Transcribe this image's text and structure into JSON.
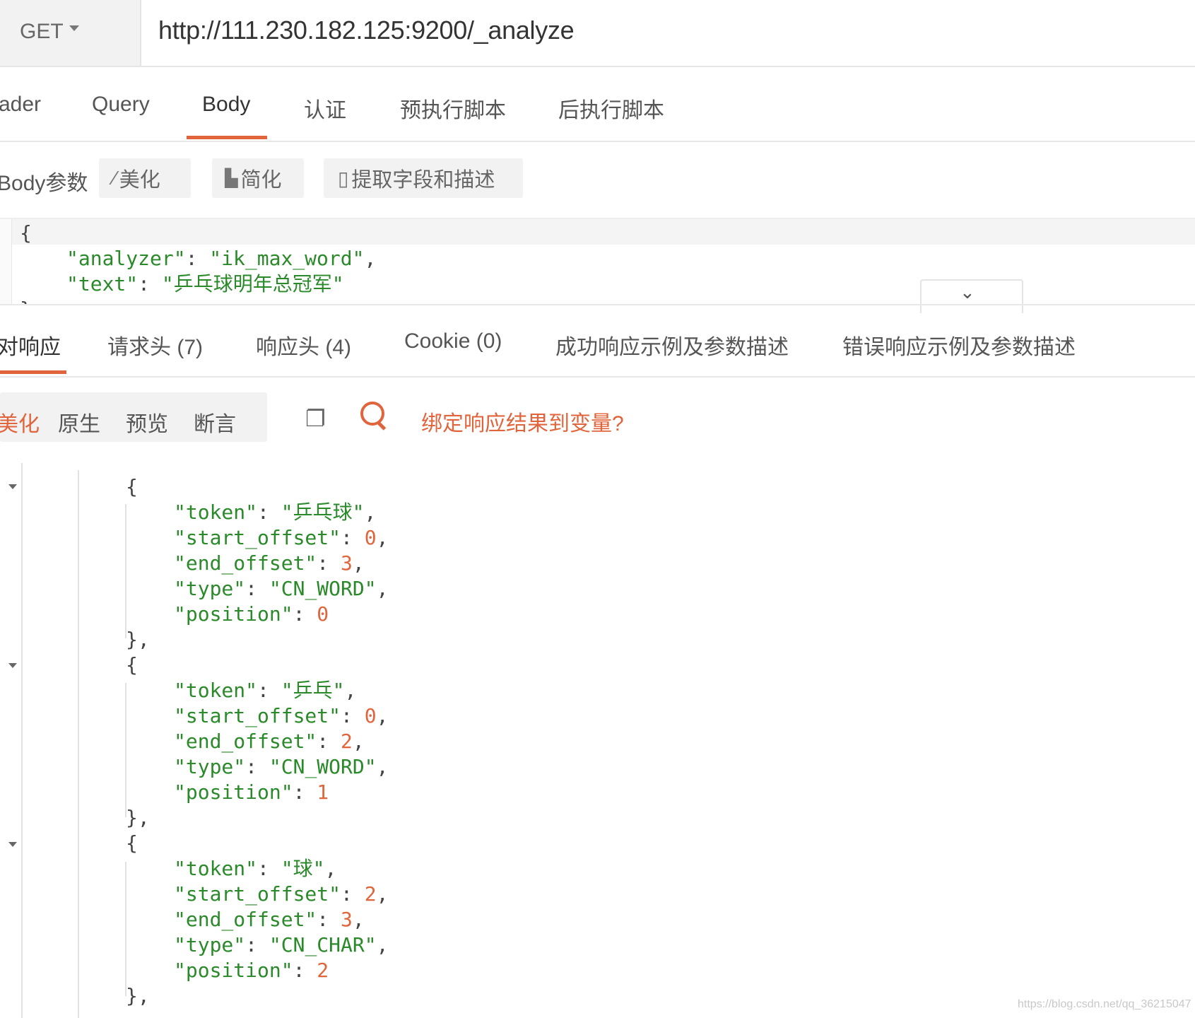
{
  "request": {
    "method": "GET",
    "url": "http://111.230.182.125:9200/_analyze"
  },
  "request_tabs": [
    {
      "label": "ader",
      "active": false
    },
    {
      "label": "Query",
      "active": false
    },
    {
      "label": "Body",
      "active": true
    },
    {
      "label": "认证",
      "active": false
    },
    {
      "label": "预执行脚本",
      "active": false
    },
    {
      "label": "后执行脚本",
      "active": false
    }
  ],
  "body_toolbar": {
    "label": "Body参数",
    "beautify": "美化",
    "simplify": "简化",
    "extract": "提取字段和描述"
  },
  "request_body": {
    "open_brace": "{",
    "k1": "\"analyzer\"",
    "v1": "\"ik_max_word\"",
    "k2": "\"text\"",
    "v2": "\"乒乓球明年总冠军\"",
    "close_brace": "}"
  },
  "response_tabs": [
    {
      "label": "对响应",
      "active": true
    },
    {
      "label": "请求头 (7)",
      "active": false
    },
    {
      "label": "响应头 (4)",
      "active": false
    },
    {
      "label": "Cookie (0)",
      "active": false
    },
    {
      "label": "成功响应示例及参数描述",
      "active": false
    },
    {
      "label": "错误响应示例及参数描述",
      "active": false
    }
  ],
  "response_toolbar": {
    "views": [
      {
        "label": "美化",
        "active": true
      },
      {
        "label": "原生",
        "active": false
      },
      {
        "label": "预览",
        "active": false
      },
      {
        "label": "断言",
        "active": false
      }
    ],
    "bind_link": "绑定响应结果到变量?"
  },
  "tokens": [
    {
      "token": "\"乒乓球\"",
      "start_offset": "0",
      "end_offset": "3",
      "type": "\"CN_WORD\"",
      "position": "0"
    },
    {
      "token": "\"乒乓\"",
      "start_offset": "0",
      "end_offset": "2",
      "type": "\"CN_WORD\"",
      "position": "1"
    },
    {
      "token": "\"球\"",
      "start_offset": "2",
      "end_offset": "3",
      "type": "\"CN_CHAR\"",
      "position": "2"
    }
  ],
  "keys": {
    "token": "\"token\"",
    "start_offset": "\"start_offset\"",
    "end_offset": "\"end_offset\"",
    "type": "\"type\"",
    "position": "\"position\""
  },
  "watermark": "https://blog.csdn.net/qq_36215047",
  "icons": {
    "method_caret": "caret-down-icon",
    "beautify": "magic-wand-icon",
    "simplify": "sitemap-icon",
    "extract": "document-icon",
    "collapse": "chevron-down-icon",
    "copy": "copy-icon",
    "search": "search-icon"
  },
  "colors": {
    "accent": "#e0643c",
    "key": "#2a8a2a",
    "number": "#e0643c"
  }
}
